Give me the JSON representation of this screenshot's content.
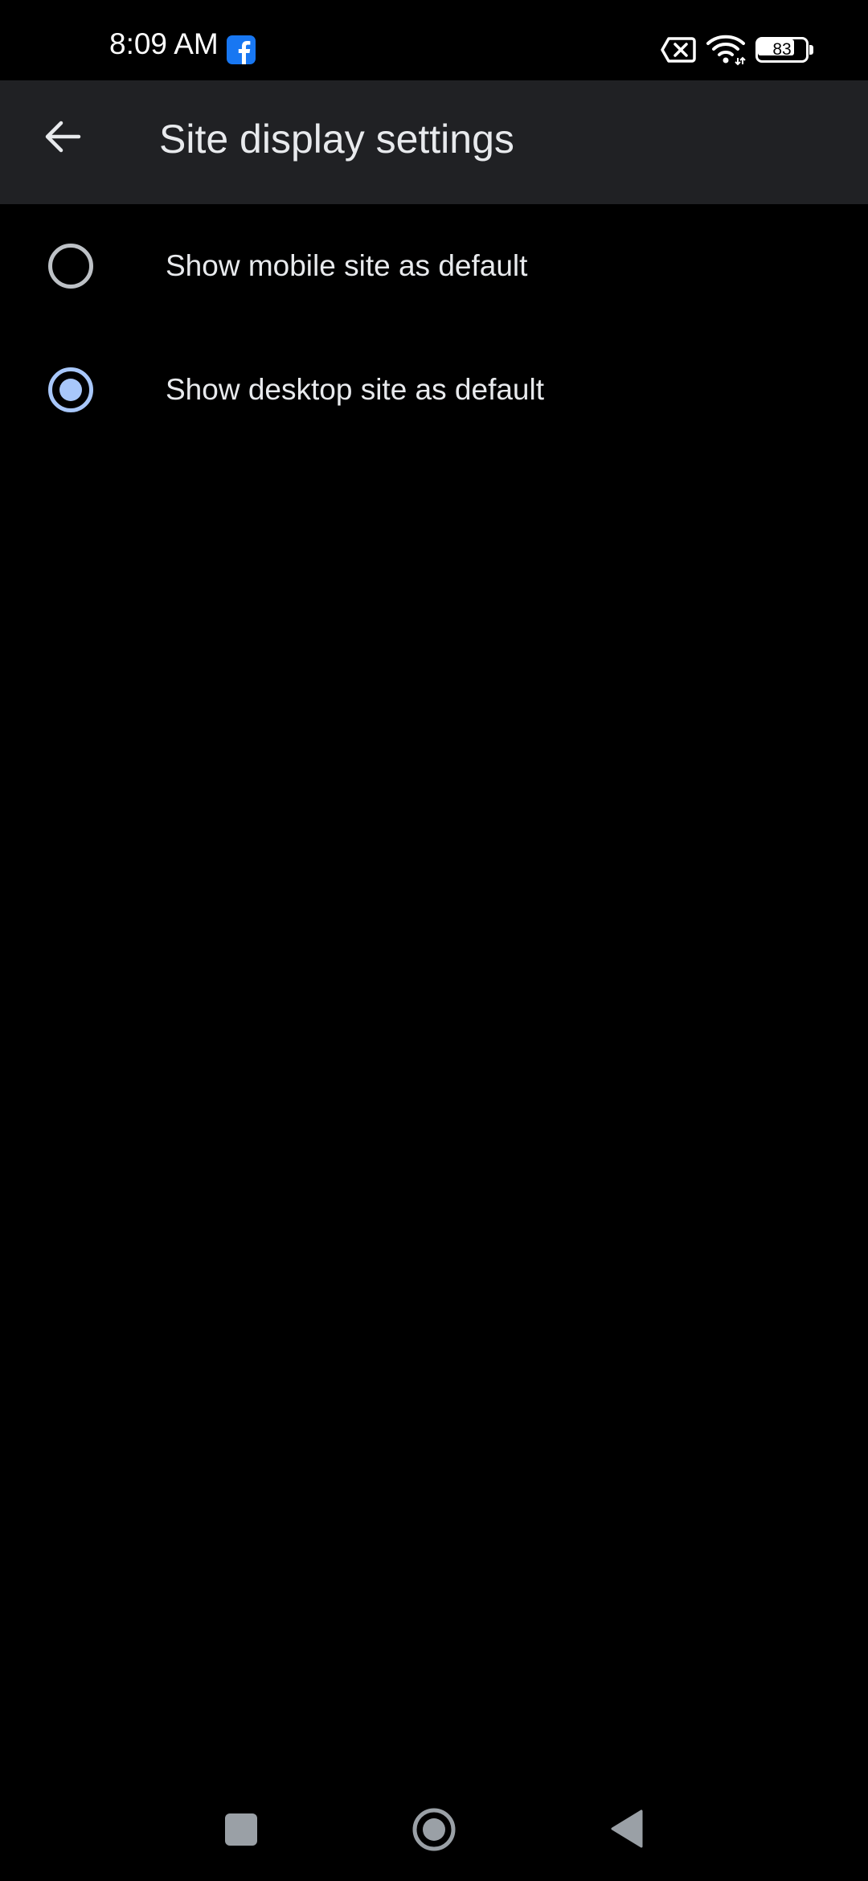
{
  "status_bar": {
    "time": "8:09 AM",
    "battery_level": "83",
    "icons": [
      "facebook-notification-icon",
      "no-sim-icon",
      "wifi-icon",
      "battery-icon"
    ]
  },
  "app_bar": {
    "title": "Site display settings",
    "back_icon": "arrow-back-icon"
  },
  "options": [
    {
      "label": "Show mobile site as default",
      "selected": false
    },
    {
      "label": "Show desktop site as default",
      "selected": true
    }
  ],
  "nav_bar": {
    "icons": [
      "recents-square-icon",
      "home-circle-icon",
      "back-triangle-icon"
    ]
  },
  "colors": {
    "background": "#000000",
    "app_bar": "#202124",
    "text": "#e8eaed",
    "accent": "#a8c7fa",
    "radio_unchecked": "#bdc1c6",
    "facebook_blue": "#1877f2"
  }
}
